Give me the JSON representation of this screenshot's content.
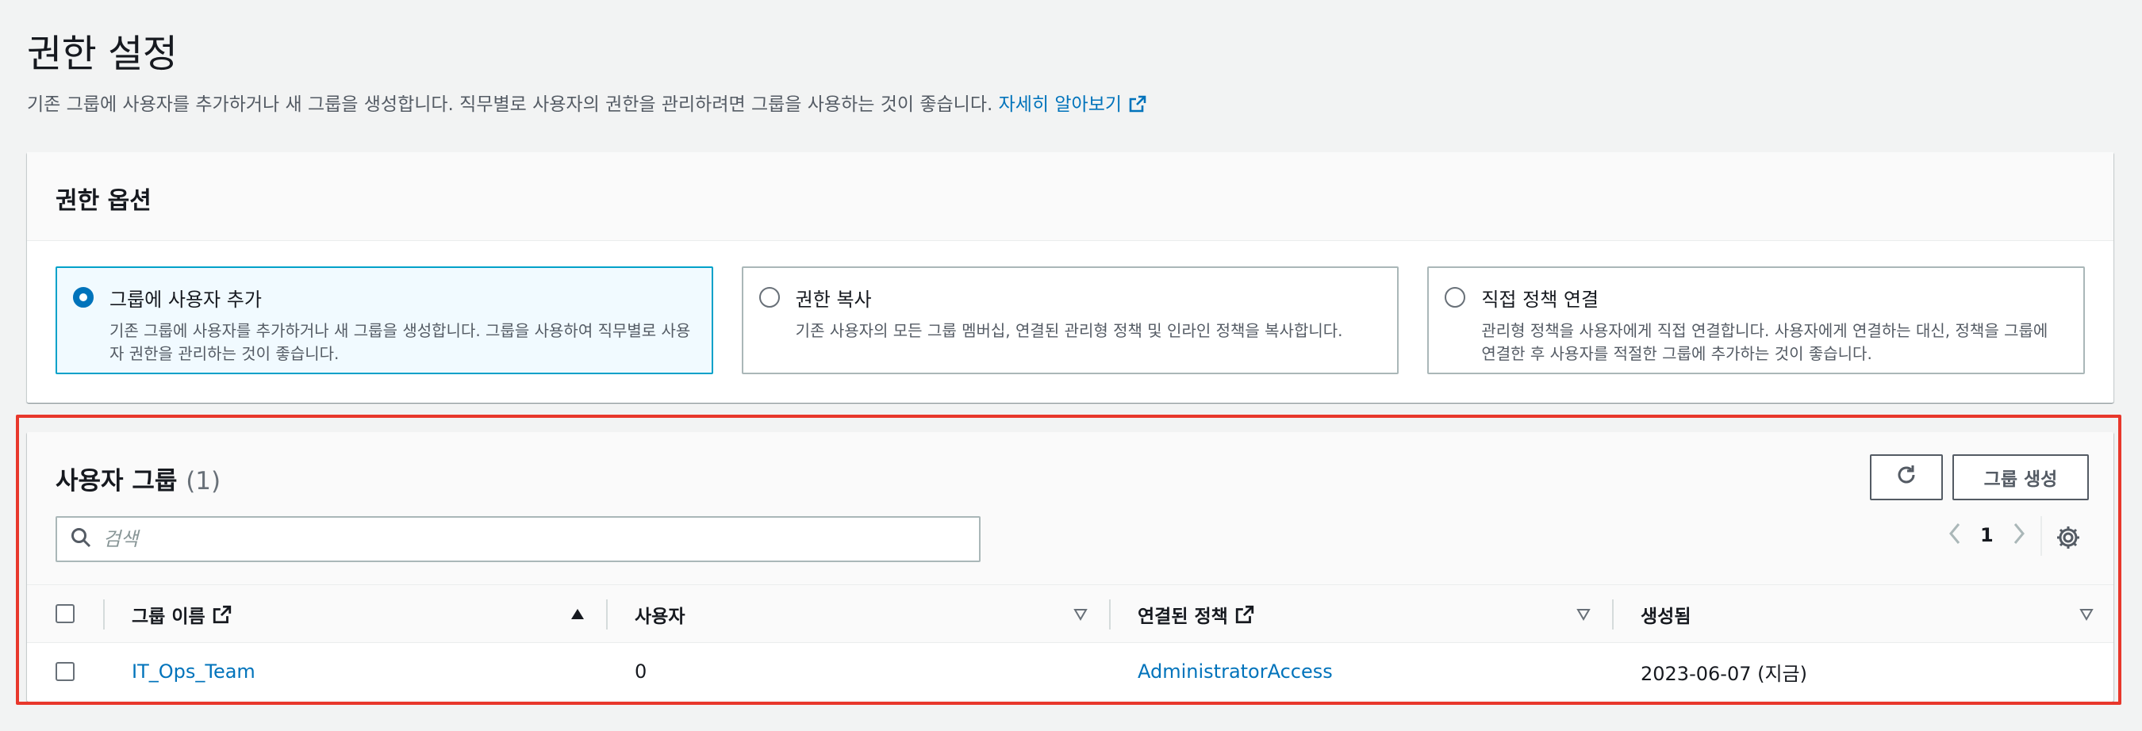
{
  "page": {
    "title": "권한 설정",
    "description": "기존 그룹에 사용자를 추가하거나 새 그룹을 생성합니다. 직무별로 사용자의 권한을 관리하려면 그룹을 사용하는 것이 좋습니다.",
    "learn_more": "자세히 알아보기",
    "accent_color": "#0073bb"
  },
  "options": {
    "title": "권한 옵션",
    "tiles": [
      {
        "label": "그룹에 사용자 추가",
        "desc": "기존 그룹에 사용자를 추가하거나 새 그룹을 생성합니다. 그룹을 사용하여 직무별로 사용자 권한을 관리하는 것이 좋습니다.",
        "selected": true
      },
      {
        "label": "권한 복사",
        "desc": "기존 사용자의 모든 그룹 멤버십, 연결된 관리형 정책 및 인라인 정책을 복사합니다.",
        "selected": false
      },
      {
        "label": "직접 정책 연결",
        "desc": "관리형 정책을 사용자에게 직접 연결합니다. 사용자에게 연결하는 대신, 정책을 그룹에 연결한 후 사용자를 적절한 그룹에 추가하는 것이 좋습니다.",
        "selected": false
      }
    ]
  },
  "groups": {
    "title": "사용자 그룹",
    "count": "(1)",
    "create_label": "그룹 생성",
    "search_placeholder": "검색",
    "page_number": "1",
    "columns": [
      "그룹 이름",
      "사용자",
      "연결된 정책",
      "생성됨"
    ],
    "rows": [
      {
        "name": "IT_Ops_Team",
        "users": "0",
        "policy": "AdministratorAccess",
        "created": "2023-06-07 (지금)"
      }
    ]
  }
}
